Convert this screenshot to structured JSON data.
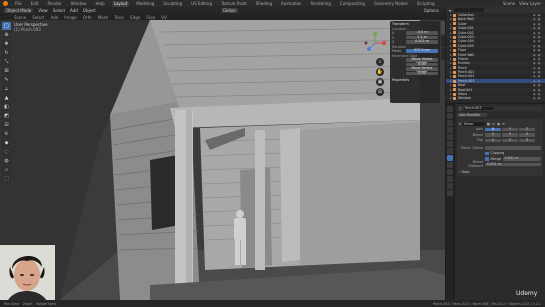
{
  "app": {
    "workspaces": [
      "File",
      "Edit",
      "Render",
      "Window",
      "Help",
      "Layout",
      "Modeling",
      "Sculpting",
      "UV Editing",
      "Texture Paint",
      "Shading",
      "Animation",
      "Rendering",
      "Compositing",
      "Geometry Nodes",
      "Scripting"
    ],
    "active_workspace": "Layout",
    "scene_label": "Scene",
    "view_layer_label": "View Layer"
  },
  "viewport_header": {
    "mode": "Object Mode",
    "menus": [
      "View",
      "Select",
      "Add",
      "Object"
    ],
    "transform_orientation": "Global",
    "options": "Options"
  },
  "viewport_header2": {
    "items": [
      "Scene",
      "Select",
      "Add",
      "Image",
      "Orth",
      "Mesh",
      "Tools",
      "Edge",
      "Face",
      "UV"
    ]
  },
  "viewport_overlay": {
    "view_name": "User Perspective",
    "object_name": "(1) Porch.003"
  },
  "sidebar_panel": {
    "section_transform": "Transform",
    "location_label": "Location:",
    "location": [
      "-4.0 m",
      "1.2 m",
      "0.502 m"
    ],
    "rotation_label": "Rotation",
    "mode_value": "XYZ Euler",
    "rows": [
      {
        "label": "Mode",
        "value": "XYZ Euler",
        "blue": true
      },
      {
        "label": "",
        "value": "Move Vertex Height",
        "blue": false
      },
      {
        "label": "",
        "value": "0.00",
        "blue": false
      }
    ],
    "modifier_header": "Keyframe Data",
    "extra_rows": [
      "Move Vertex Height",
      "0.00"
    ],
    "section_properties": "Properties"
  },
  "outliner": {
    "rows": [
      {
        "name": "Collection",
        "selected": false
      },
      {
        "name": "Back Wall",
        "selected": false
      },
      {
        "name": "Cube",
        "selected": false
      },
      {
        "name": "Cube.001",
        "selected": false
      },
      {
        "name": "Cube.002",
        "selected": false
      },
      {
        "name": "Cube.003",
        "selected": false
      },
      {
        "name": "Cube.004",
        "selected": false
      },
      {
        "name": "Cube.005",
        "selected": false
      },
      {
        "name": "Floor",
        "selected": false
      },
      {
        "name": "Front Wall",
        "selected": false
      },
      {
        "name": "Frame",
        "selected": false
      },
      {
        "name": "Human",
        "selected": false
      },
      {
        "name": "Porch",
        "selected": false
      },
      {
        "name": "Porch.001",
        "selected": false
      },
      {
        "name": "Porch.002",
        "selected": false
      },
      {
        "name": "Porch.003",
        "selected": true
      },
      {
        "name": "Roof",
        "selected": false
      },
      {
        "name": "Roof.001",
        "selected": false
      },
      {
        "name": "Steps",
        "selected": false
      },
      {
        "name": "Window",
        "selected": false
      }
    ]
  },
  "properties": {
    "object_name": "Porch.003",
    "add_modifier": "Add Modifier",
    "modifier_name": "Mirror",
    "axis_label": "Axis",
    "bisect_label": "Bisect",
    "flip_label": "Flip",
    "axes": [
      "X",
      "Y",
      "Z"
    ],
    "mirror_object_label": "Mirror Object",
    "clipping_label": "Clipping",
    "merge_label": "Merge",
    "merge_value": "0.001 m",
    "bisect_distance_label": "Bisect Distance",
    "bisect_distance_value": "0.001 m",
    "data_label": "Data"
  },
  "statusbar": {
    "left": [
      "Pan View",
      "Zoom",
      "Rotate View"
    ],
    "stats": "Porch.003 | Verts 0/12 | Faces 0/6 | Tris 0/12 | Objects 1/22 | 3.2.1"
  },
  "watermark": "Udemy"
}
